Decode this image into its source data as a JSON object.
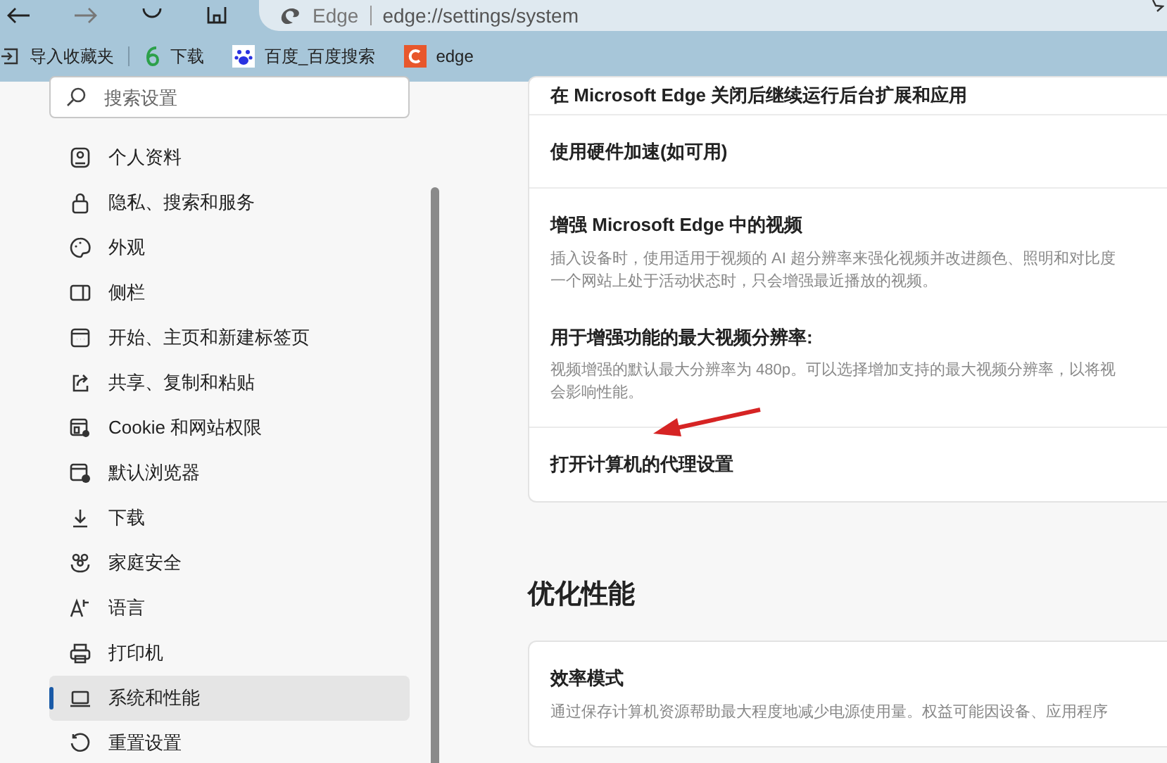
{
  "browser": {
    "site_label": "Edge",
    "address": "edge://settings/system"
  },
  "bookmarks": [
    {
      "kind": "import",
      "label": "导入收藏夹"
    },
    {
      "kind": "six",
      "label": "下载"
    },
    {
      "kind": "paw",
      "label": "百度_百度搜索"
    },
    {
      "kind": "c",
      "label": "edge"
    }
  ],
  "sidebar": {
    "search": {
      "placeholder": "搜索设置"
    },
    "items": [
      {
        "label": "个人资料",
        "selected": false
      },
      {
        "label": "隐私、搜索和服务",
        "selected": false
      },
      {
        "label": "外观",
        "selected": false
      },
      {
        "label": "侧栏",
        "selected": false
      },
      {
        "label": "开始、主页和新建标签页",
        "selected": false
      },
      {
        "label": "共享、复制和粘贴",
        "selected": false
      },
      {
        "label": "Cookie 和网站权限",
        "selected": false
      },
      {
        "label": "默认浏览器",
        "selected": false
      },
      {
        "label": "下载",
        "selected": false
      },
      {
        "label": "家庭安全",
        "selected": false
      },
      {
        "label": "语言",
        "selected": false
      },
      {
        "label": "打印机",
        "selected": false
      },
      {
        "label": "系统和性能",
        "selected": true
      },
      {
        "label": "重置设置",
        "selected": false
      }
    ]
  },
  "system_card": {
    "rows": [
      {
        "title": "在 Microsoft Edge 关闭后继续运行后台扩展和应用"
      },
      {
        "title": "使用硬件加速(如可用)"
      },
      {
        "title": "增强 Microsoft Edge 中的视频",
        "description": "插入设备时，使用适用于视频的 AI 超分辨率来强化视频并改进颜色、照明和对比度",
        "description_2": "一个网站上处于活动状态时，只会增强最近播放的视频。",
        "sub_title": "用于增强功能的最大视频分辨率:",
        "sub_description": "视频增强的默认最大分辨率为 480p。可以选择增加支持的最大视频分辨率，以将视",
        "sub_description_2": "会影响性能。"
      },
      {
        "title": "打开计算机的代理设置"
      }
    ]
  },
  "performance": {
    "heading": "优化性能",
    "rows": [
      {
        "title": "效率模式",
        "description": "通过保存计算机资源帮助最大程度地减少电源使用量。权益可能因设备、应用程序"
      }
    ]
  }
}
